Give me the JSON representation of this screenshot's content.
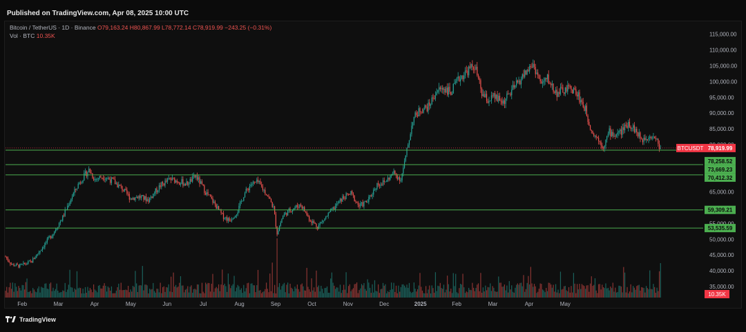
{
  "header": {
    "published": "Published on TradingView.com, Apr 08, 2025 10:00 UTC"
  },
  "legend": {
    "symbol": "Bitcoin / TetherUS · 1D · Binance",
    "ohlc": "O79,163.24 H80,867.99 L78,772.14 C78,919.99 −243.25 (−0.31%)",
    "volume_label": "Vol · BTC",
    "volume_value": "10.35K"
  },
  "footer": {
    "brand": "TradingView",
    "logo_icon": "tradingview-logo-icon"
  },
  "colors": {
    "up": "#26a69a",
    "down": "#ef5350",
    "level": "#4caf50",
    "price_tag": "#f23645",
    "level_tag": "#4caf50",
    "bg": "#0f0f0f"
  },
  "chart_data": {
    "type": "candlestick",
    "ylim": [
      31500,
      118000
    ],
    "yticks": [
      {
        "value": 115000,
        "label": "115,000.00"
      },
      {
        "value": 110000,
        "label": "110,000.00"
      },
      {
        "value": 105000,
        "label": "105,000.00"
      },
      {
        "value": 100000,
        "label": "100,000.00"
      },
      {
        "value": 95000,
        "label": "95,000.00"
      },
      {
        "value": 90000,
        "label": "90,000.00"
      },
      {
        "value": 85000,
        "label": "85,000.00"
      },
      {
        "value": 80000,
        "label": "80,000.00"
      },
      {
        "value": 65000,
        "label": "65,000.00"
      },
      {
        "value": 55000,
        "label": "55,000.00"
      },
      {
        "value": 50000,
        "label": "50,000.00"
      },
      {
        "value": 45000,
        "label": "45,000.00"
      },
      {
        "value": 40000,
        "label": "40,000.00"
      },
      {
        "value": 35000,
        "label": "35,000.00"
      }
    ],
    "xlabels": [
      "Feb",
      "Mar",
      "Apr",
      "May",
      "Jun",
      "Jul",
      "Aug",
      "Sep",
      "Oct",
      "Nov",
      "Dec",
      "2025",
      "Feb",
      "Mar",
      "Apr",
      "May"
    ],
    "xlabel_months": [
      1,
      2,
      3,
      4,
      5,
      6,
      7,
      8,
      9,
      10,
      11,
      12,
      13,
      14,
      15,
      16
    ],
    "bold_xlabel": "2025",
    "first_month_offset_days": 14,
    "price_tag": {
      "symbol": "BTCUSDT",
      "label": "78,919.99",
      "value": 78919.99
    },
    "levels": [
      {
        "label": "78,258.52",
        "value": 78258.52
      },
      {
        "label": "73,669.23",
        "value": 73669.23
      },
      {
        "label": "70,412.32",
        "value": 70412.32
      },
      {
        "label": "59,309.21",
        "value": 59309.21
      },
      {
        "label": "53,535.59",
        "value": 53535.59
      }
    ],
    "volume_tag": "10.35K",
    "price_path": [
      [
        0,
        44500
      ],
      [
        5,
        42000
      ],
      [
        12,
        41500
      ],
      [
        22,
        43000
      ],
      [
        30,
        47000
      ],
      [
        40,
        52000
      ],
      [
        48,
        57000
      ],
      [
        55,
        63000
      ],
      [
        62,
        68000
      ],
      [
        70,
        72000
      ],
      [
        75,
        69000
      ],
      [
        82,
        70000
      ],
      [
        90,
        68500
      ],
      [
        98,
        66000
      ],
      [
        105,
        63000
      ],
      [
        112,
        63500
      ],
      [
        120,
        62500
      ],
      [
        130,
        67000
      ],
      [
        138,
        69000
      ],
      [
        145,
        68500
      ],
      [
        152,
        67500
      ],
      [
        160,
        70000
      ],
      [
        168,
        65000
      ],
      [
        175,
        61500
      ],
      [
        182,
        57500
      ],
      [
        188,
        56000
      ],
      [
        195,
        59000
      ],
      [
        200,
        64000
      ],
      [
        206,
        67500
      ],
      [
        212,
        68000
      ],
      [
        220,
        64000
      ],
      [
        225,
        60000
      ],
      [
        228,
        52000
      ],
      [
        233,
        57500
      ],
      [
        240,
        59500
      ],
      [
        248,
        61000
      ],
      [
        255,
        56500
      ],
      [
        262,
        54000
      ],
      [
        268,
        56500
      ],
      [
        276,
        60000
      ],
      [
        283,
        63000
      ],
      [
        290,
        64500
      ],
      [
        297,
        60500
      ],
      [
        304,
        62000
      ],
      [
        312,
        67500
      ],
      [
        318,
        68000
      ],
      [
        326,
        71000
      ],
      [
        332,
        69000
      ],
      [
        336,
        76000
      ],
      [
        342,
        88000
      ],
      [
        348,
        91000
      ],
      [
        355,
        92000
      ],
      [
        362,
        97000
      ],
      [
        368,
        98000
      ],
      [
        374,
        96500
      ],
      [
        381,
        101000
      ],
      [
        388,
        103500
      ],
      [
        394,
        105000
      ],
      [
        400,
        96000
      ],
      [
        405,
        94000
      ],
      [
        410,
        95000
      ],
      [
        418,
        93500
      ],
      [
        425,
        97000
      ],
      [
        430,
        99500
      ],
      [
        437,
        103000
      ],
      [
        443,
        105500
      ],
      [
        450,
        99000
      ],
      [
        455,
        101000
      ],
      [
        462,
        96500
      ],
      [
        468,
        97000
      ],
      [
        475,
        98000
      ],
      [
        481,
        95500
      ],
      [
        487,
        91000
      ],
      [
        492,
        84500
      ],
      [
        497,
        82000
      ],
      [
        502,
        79500
      ],
      [
        507,
        84000
      ],
      [
        512,
        83000
      ],
      [
        518,
        84500
      ],
      [
        523,
        87000
      ],
      [
        528,
        85000
      ],
      [
        534,
        81500
      ],
      [
        540,
        83000
      ],
      [
        545,
        82500
      ],
      [
        550,
        78919
      ]
    ]
  }
}
